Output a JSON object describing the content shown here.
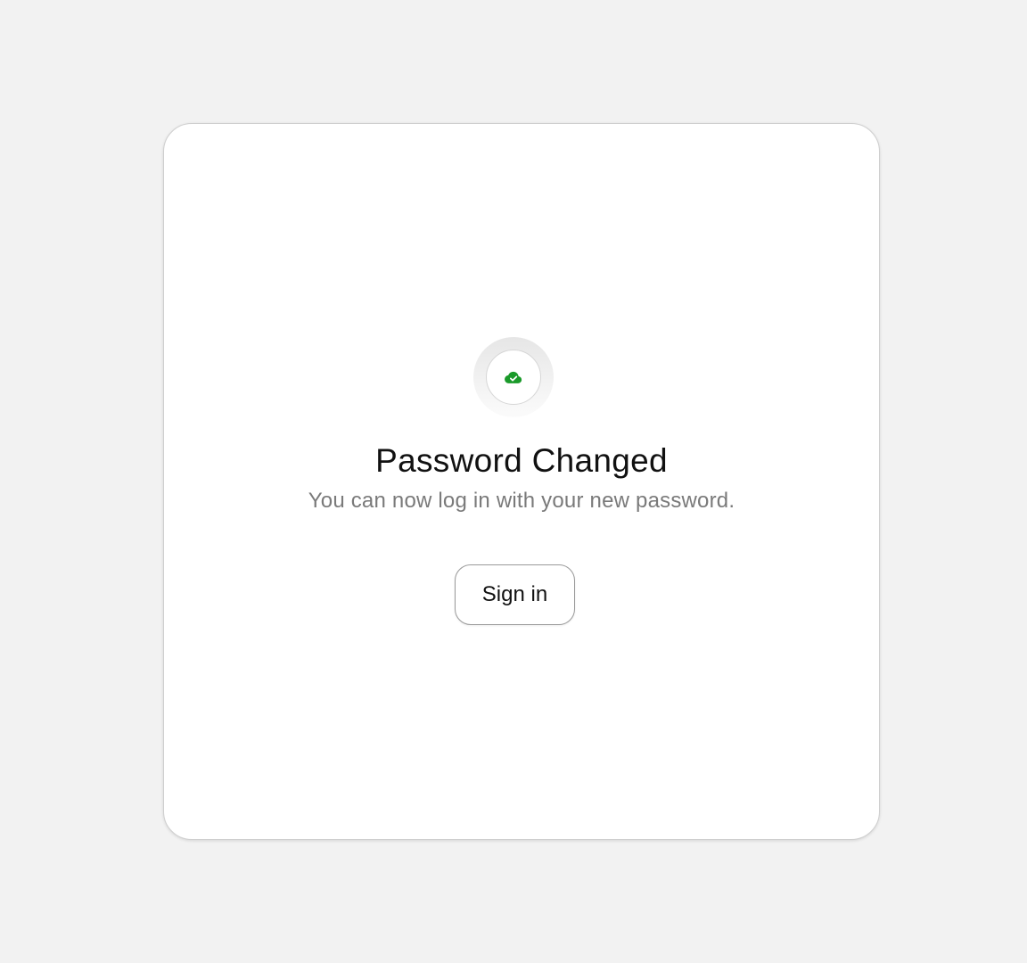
{
  "dialog": {
    "icon": "cloud-check-icon",
    "icon_color": "#1a9a2a",
    "title": "Password Changed",
    "message": "You can now log in with your new password.",
    "button_label": "Sign in"
  },
  "colors": {
    "background": "#f2f2f2",
    "card": "#ffffff",
    "title_text": "#111111",
    "message_text": "#7a7a7a"
  }
}
